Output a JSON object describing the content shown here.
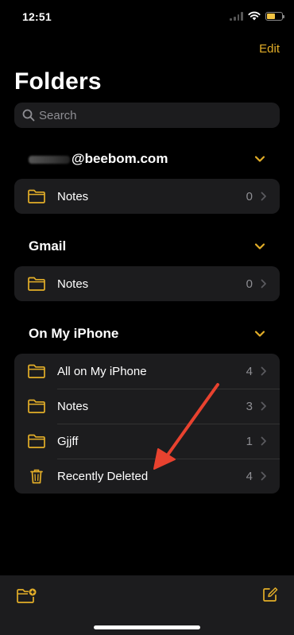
{
  "status_bar": {
    "time": "12:51"
  },
  "nav": {
    "edit_label": "Edit",
    "title": "Folders"
  },
  "search": {
    "placeholder": "Search"
  },
  "sections": {
    "account": {
      "title": "@beebom.com",
      "rows": [
        {
          "icon": "folder-icon",
          "label": "Notes",
          "count": "0"
        }
      ]
    },
    "gmail": {
      "title": "Gmail",
      "rows": [
        {
          "icon": "folder-icon",
          "label": "Notes",
          "count": "0"
        }
      ]
    },
    "iphone": {
      "title": "On My iPhone",
      "rows": [
        {
          "icon": "folder-icon",
          "label": "All on My iPhone",
          "count": "4"
        },
        {
          "icon": "folder-icon",
          "label": "Notes",
          "count": "3"
        },
        {
          "icon": "folder-icon",
          "label": "Gjjff",
          "count": "1"
        },
        {
          "icon": "trash-icon",
          "label": "Recently Deleted",
          "count": "4"
        }
      ]
    }
  },
  "toolbar": {
    "left_icon": "new-folder-icon",
    "right_icon": "compose-icon"
  },
  "colors": {
    "accent": "#e3ae28",
    "background": "#000000",
    "card": "#1c1c1e",
    "annotation": "#e8422f"
  }
}
